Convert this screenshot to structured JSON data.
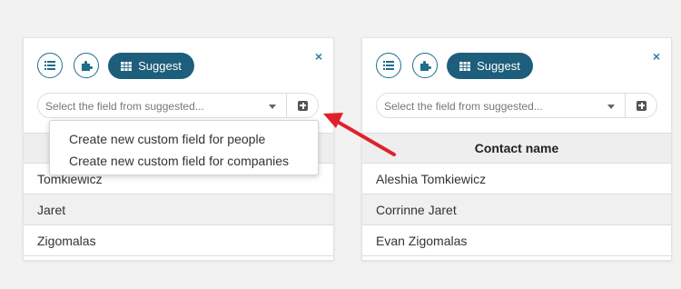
{
  "panels": [
    {
      "suggest_label": "Suggest",
      "select_placeholder": "Select the field from suggested...",
      "close_label": "×",
      "header": "",
      "rows": [
        "Tomkiewicz",
        "Jaret",
        "Zigomalas"
      ],
      "dropdown_items": [
        "Create new custom field for people",
        "Create new custom field for companies"
      ]
    },
    {
      "suggest_label": "Suggest",
      "select_placeholder": "Select the field from suggested...",
      "close_label": "×",
      "header": "Contact name",
      "rows": [
        "Aleshia Tomkiewicz",
        "Corrinne Jaret",
        "Evan Zigomalas"
      ]
    }
  ],
  "icons": {
    "list": "list-icon",
    "puzzle": "puzzle-icon",
    "grid": "table-grid-icon",
    "add": "plus-square-icon",
    "caret": "caret-down-icon",
    "close": "close-icon"
  },
  "colors": {
    "accent": "#1d5e7c",
    "close": "#2a7fa8",
    "arrow": "#e0212b",
    "background": "#f2f2f2"
  }
}
